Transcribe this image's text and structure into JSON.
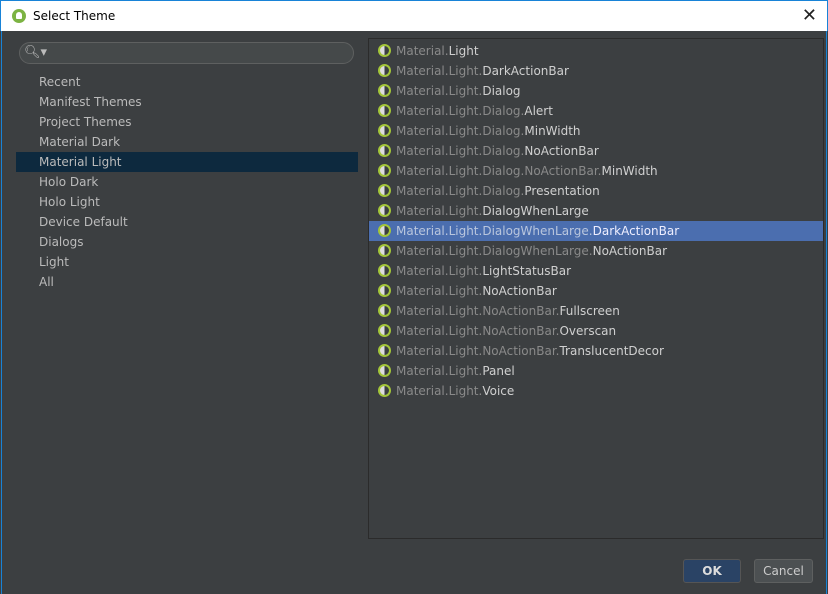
{
  "window": {
    "title": "Select Theme",
    "close": "✕"
  },
  "search": {
    "placeholder": "",
    "icon": "search-icon"
  },
  "categories": [
    {
      "label": "Recent"
    },
    {
      "label": "Manifest Themes"
    },
    {
      "label": "Project Themes"
    },
    {
      "label": "Material Dark"
    },
    {
      "label": "Material Light",
      "selected": true
    },
    {
      "label": "Holo Dark"
    },
    {
      "label": "Holo Light"
    },
    {
      "label": "Device Default"
    },
    {
      "label": "Dialogs"
    },
    {
      "label": "Light"
    },
    {
      "label": "All"
    }
  ],
  "themes": [
    {
      "prefix": "Material.",
      "suffix": "Light"
    },
    {
      "prefix": "Material.Light.",
      "suffix": "DarkActionBar"
    },
    {
      "prefix": "Material.Light.",
      "suffix": "Dialog"
    },
    {
      "prefix": "Material.Light.Dialog.",
      "suffix": "Alert"
    },
    {
      "prefix": "Material.Light.Dialog.",
      "suffix": "MinWidth"
    },
    {
      "prefix": "Material.Light.Dialog.",
      "suffix": "NoActionBar"
    },
    {
      "prefix": "Material.Light.Dialog.NoActionBar.",
      "suffix": "MinWidth"
    },
    {
      "prefix": "Material.Light.Dialog.",
      "suffix": "Presentation"
    },
    {
      "prefix": "Material.Light.",
      "suffix": "DialogWhenLarge"
    },
    {
      "prefix": "Material.Light.DialogWhenLarge.",
      "suffix": "DarkActionBar",
      "selected": true
    },
    {
      "prefix": "Material.Light.DialogWhenLarge.",
      "suffix": "NoActionBar"
    },
    {
      "prefix": "Material.Light.",
      "suffix": "LightStatusBar"
    },
    {
      "prefix": "Material.Light.",
      "suffix": "NoActionBar"
    },
    {
      "prefix": "Material.Light.NoActionBar.",
      "suffix": "Fullscreen"
    },
    {
      "prefix": "Material.Light.NoActionBar.",
      "suffix": "Overscan"
    },
    {
      "prefix": "Material.Light.NoActionBar.",
      "suffix": "TranslucentDecor"
    },
    {
      "prefix": "Material.Light.",
      "suffix": "Panel"
    },
    {
      "prefix": "Material.Light.",
      "suffix": "Voice"
    }
  ],
  "buttons": {
    "ok": "OK",
    "cancel": "Cancel"
  },
  "colors": {
    "selection": "#4b6eaf",
    "category_selection": "#0d293e",
    "theme_icon": "#a4c639"
  }
}
